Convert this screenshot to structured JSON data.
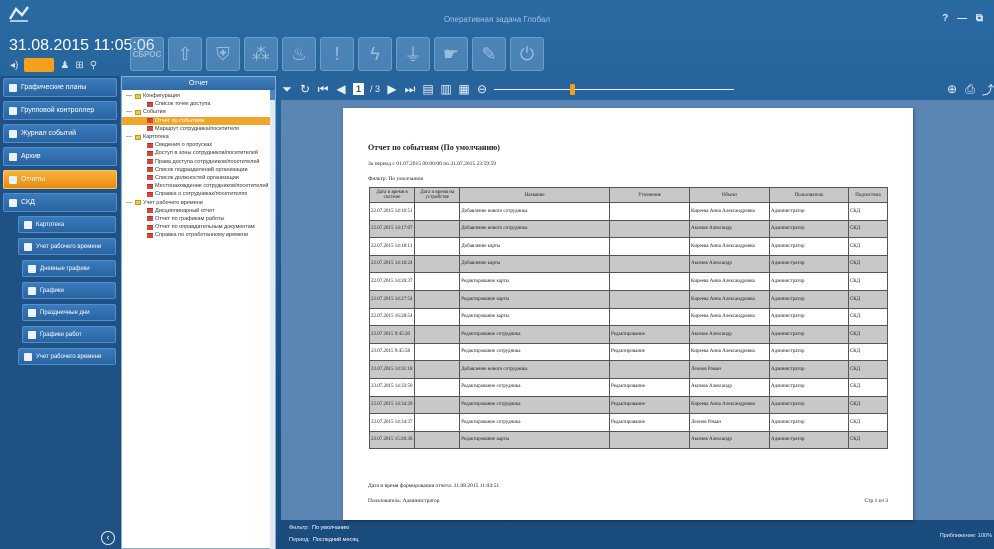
{
  "app": {
    "title": "Оперативная задача Глобал",
    "window_controls": "? — ⧉"
  },
  "status": {
    "datetime": "31.08.2015 11:05:06"
  },
  "actions": {
    "reset_label": "СБРОС"
  },
  "colors": {
    "accent": "#f5a01a",
    "panel": "#1f5185",
    "selected": "#f2a52b"
  },
  "nav": {
    "items": [
      {
        "label": "Графические планы"
      },
      {
        "label": "Групповой контроллер"
      },
      {
        "label": "Журнал событий"
      },
      {
        "label": "Архив"
      },
      {
        "label": "Отчеты"
      },
      {
        "label": "СКД"
      },
      {
        "label": "Картотека"
      },
      {
        "label": "Учет рабочего времени"
      },
      {
        "label": "Дневные графики"
      },
      {
        "label": "Графики"
      },
      {
        "label": "Праздничные дни"
      },
      {
        "label": "Графики работ"
      },
      {
        "label": "Учет рабочего времени"
      }
    ]
  },
  "tree": {
    "header": "Отчет",
    "nodes": [
      {
        "label": "Конфигурация"
      },
      {
        "label": "Список точек доступа"
      },
      {
        "label": "События"
      },
      {
        "label": "Отчет по событиям"
      },
      {
        "label": "Маршрут сотрудника/посетителя"
      },
      {
        "label": "Картотека"
      },
      {
        "label": "Сведения о пропусках"
      },
      {
        "label": "Доступ в зоны сотрудников/посетителей"
      },
      {
        "label": "Права доступа сотрудников/посетителей"
      },
      {
        "label": "Список подразделений организации"
      },
      {
        "label": "Список должностей организации"
      },
      {
        "label": "Местонахождение сотрудников/посетителей"
      },
      {
        "label": "Справка о сотрудниках/посетителях"
      },
      {
        "label": "Учет рабочего времени"
      },
      {
        "label": "Дисциплинарный отчет"
      },
      {
        "label": "Отчет по графикам работы"
      },
      {
        "label": "Отчет по оправдательным документам"
      },
      {
        "label": "Справка по отработанному времени"
      }
    ]
  },
  "viewer": {
    "page": "1",
    "total": "/ 3"
  },
  "report": {
    "title": "Отчет по событиям (По умолчанию)",
    "period": "За период с 01.07.2015 00:00:00 по 31.07.2015 23:59:59",
    "filter": "Фильтр: По умолчанию",
    "columns": [
      "Дата и время в системе",
      "Дата и время на устройстве",
      "Название",
      "Уточнение",
      "Объект",
      "Пользователь",
      "Подсистема"
    ],
    "rows": [
      [
        "22.07.2015 14:16:51",
        "",
        "Добавление нового сотрудника",
        "",
        "Киреева Анна Александровна",
        "Администратор",
        "СКД"
      ],
      [
        "22.07.2015 14:17:07",
        "",
        "Добавление нового сотрудника",
        "",
        "Акимов Александр",
        "Администратор",
        "СКД"
      ],
      [
        "22.07.2015 14:18:11",
        "",
        "Добавление карты",
        "",
        "Киреева Анна Александровна",
        "Администратор",
        "СКД"
      ],
      [
        "22.07.2015 14:18:24",
        "",
        "Добавление карты",
        "",
        "Акимов Александр",
        "Администратор",
        "СКД"
      ],
      [
        "22.07.2015 14:26:37",
        "",
        "Редактирование карты",
        "",
        "Киреева Анна Александровна",
        "Администратор",
        "СКД"
      ],
      [
        "22.07.2015 14:27:54",
        "",
        "Редактирование карты",
        "",
        "Киреева Анна Александровна",
        "Администратор",
        "СКД"
      ],
      [
        "22.07.2015 16:28:54",
        "",
        "Редактирование карты",
        "",
        "Киреева Анна Александровна",
        "Администратор",
        "СКД"
      ],
      [
        "23.07.2015 9:45:20",
        "",
        "Редактирование сотрудника",
        "Редактирование",
        "Акимов Александр",
        "Администратор",
        "СКД"
      ],
      [
        "23.07.2015 9:45:58",
        "",
        "Редактирование сотрудника",
        "Редактирование",
        "Киреева Анна Александровна",
        "Администратор",
        "СКД"
      ],
      [
        "23.07.2015 14:31:18",
        "",
        "Добавление нового сотрудника",
        "",
        "Леонов Роман",
        "Администратор",
        "СКД"
      ],
      [
        "23.07.2015 14:33:50",
        "",
        "Редактирование сотрудника",
        "Редактирование",
        "Акимов Александр",
        "Администратор",
        "СКД"
      ],
      [
        "23.07.2015 14:34:29",
        "",
        "Редактирование сотрудника",
        "Редактирование",
        "Киреева Анна Александровна",
        "Администратор",
        "СКД"
      ],
      [
        "23.07.2015 14:34:37",
        "",
        "Редактирование сотрудника",
        "Редактирование",
        "Леонов Роман",
        "Администратор",
        "СКД"
      ],
      [
        "23.07.2015 15:26:36",
        "",
        "Редактирование карты",
        "",
        "Акимов Александр",
        "Администратор",
        "СКД"
      ]
    ],
    "generated": "Дата и время формирования отчета: 31.08.2015 11:04:51",
    "user": "Пользователь: Администратор",
    "page_of": "Стр 1 из 3"
  },
  "footer": {
    "filter_label": "Фильтр:",
    "filter_value": "По умолчанию",
    "period_label": "Период:",
    "period_value": "Последний месяц",
    "zoom": "Приближение: 100%"
  }
}
